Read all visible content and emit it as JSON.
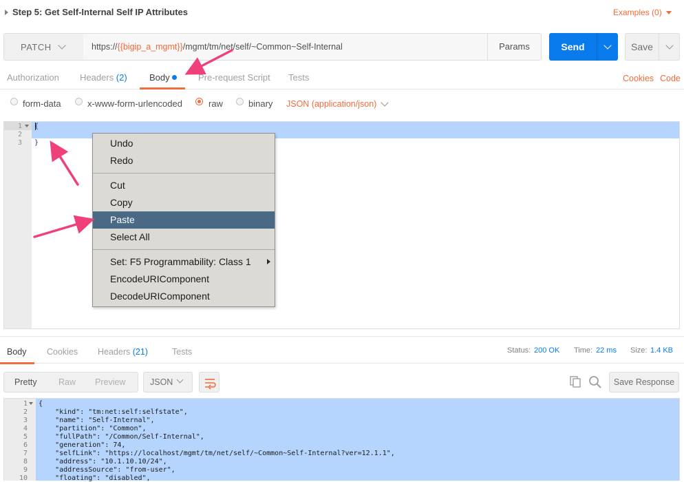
{
  "request": {
    "title": "Step 5: Get Self-Internal Self IP Attributes",
    "examples_label": "Examples (0)",
    "method": "PATCH",
    "url_prefix": "https://",
    "url_var": "{{bigip_a_mgmt}}",
    "url_suffix": "/mgmt/tm/net/self/~Common~Self-Internal",
    "params_label": "Params",
    "send_label": "Send",
    "save_label": "Save"
  },
  "request_tabs": {
    "authorization": "Authorization",
    "headers": "Headers",
    "headers_count": "(2)",
    "body": "Body",
    "pre_request": "Pre-request Script",
    "tests": "Tests",
    "cookies": "Cookies",
    "code": "Code"
  },
  "body_types": {
    "form_data": "form-data",
    "urlencoded": "x-www-form-urlencoded",
    "raw": "raw",
    "binary": "binary",
    "selected": "raw",
    "content_type": "JSON (application/json)"
  },
  "request_editor": {
    "line_numbers": [
      "1",
      "2",
      "3"
    ],
    "lines": [
      "{",
      "",
      "}"
    ]
  },
  "context_menu": {
    "undo": "Undo",
    "redo": "Redo",
    "cut": "Cut",
    "copy": "Copy",
    "paste": "Paste",
    "select_all": "Select All",
    "set_class": "Set: F5 Programmability: Class 1",
    "encode": "EncodeURIComponent",
    "decode": "DecodeURIComponent",
    "highlighted": "Paste"
  },
  "response": {
    "tabs": {
      "body": "Body",
      "cookies": "Cookies",
      "headers": "Headers",
      "headers_count": "(21)",
      "tests": "Tests"
    },
    "status_label": "Status:",
    "status_value": "200 OK",
    "time_label": "Time:",
    "time_value": "22 ms",
    "size_label": "Size:",
    "size_value": "1.4 KB",
    "view_pretty": "Pretty",
    "view_raw": "Raw",
    "view_preview": "Preview",
    "format": "JSON",
    "save_response": "Save Response",
    "line_numbers": [
      "1",
      "2",
      "3",
      "4",
      "5",
      "6",
      "7",
      "8",
      "9",
      "10"
    ],
    "lines": [
      "{",
      "    \"kind\": \"tm:net:self:selfstate\",",
      "    \"name\": \"Self-Internal\",",
      "    \"partition\": \"Common\",",
      "    \"fullPath\": \"/Common/Self-Internal\",",
      "    \"generation\": 74,",
      "    \"selfLink\": \"https://localhost/mgmt/tm/net/self/~Common~Self-Internal?ver=12.1.1\",",
      "    \"address\": \"10.1.10.10/24\",",
      "    \"addressSource\": \"from-user\",",
      "    \"floating\": \"disabled\","
    ]
  },
  "colors": {
    "accent": "#f26b3a",
    "primary": "#097bed",
    "menu_highlight": "#4a6984",
    "selection": "#b5d5ff",
    "annotation_arrow": "#f0407a"
  }
}
